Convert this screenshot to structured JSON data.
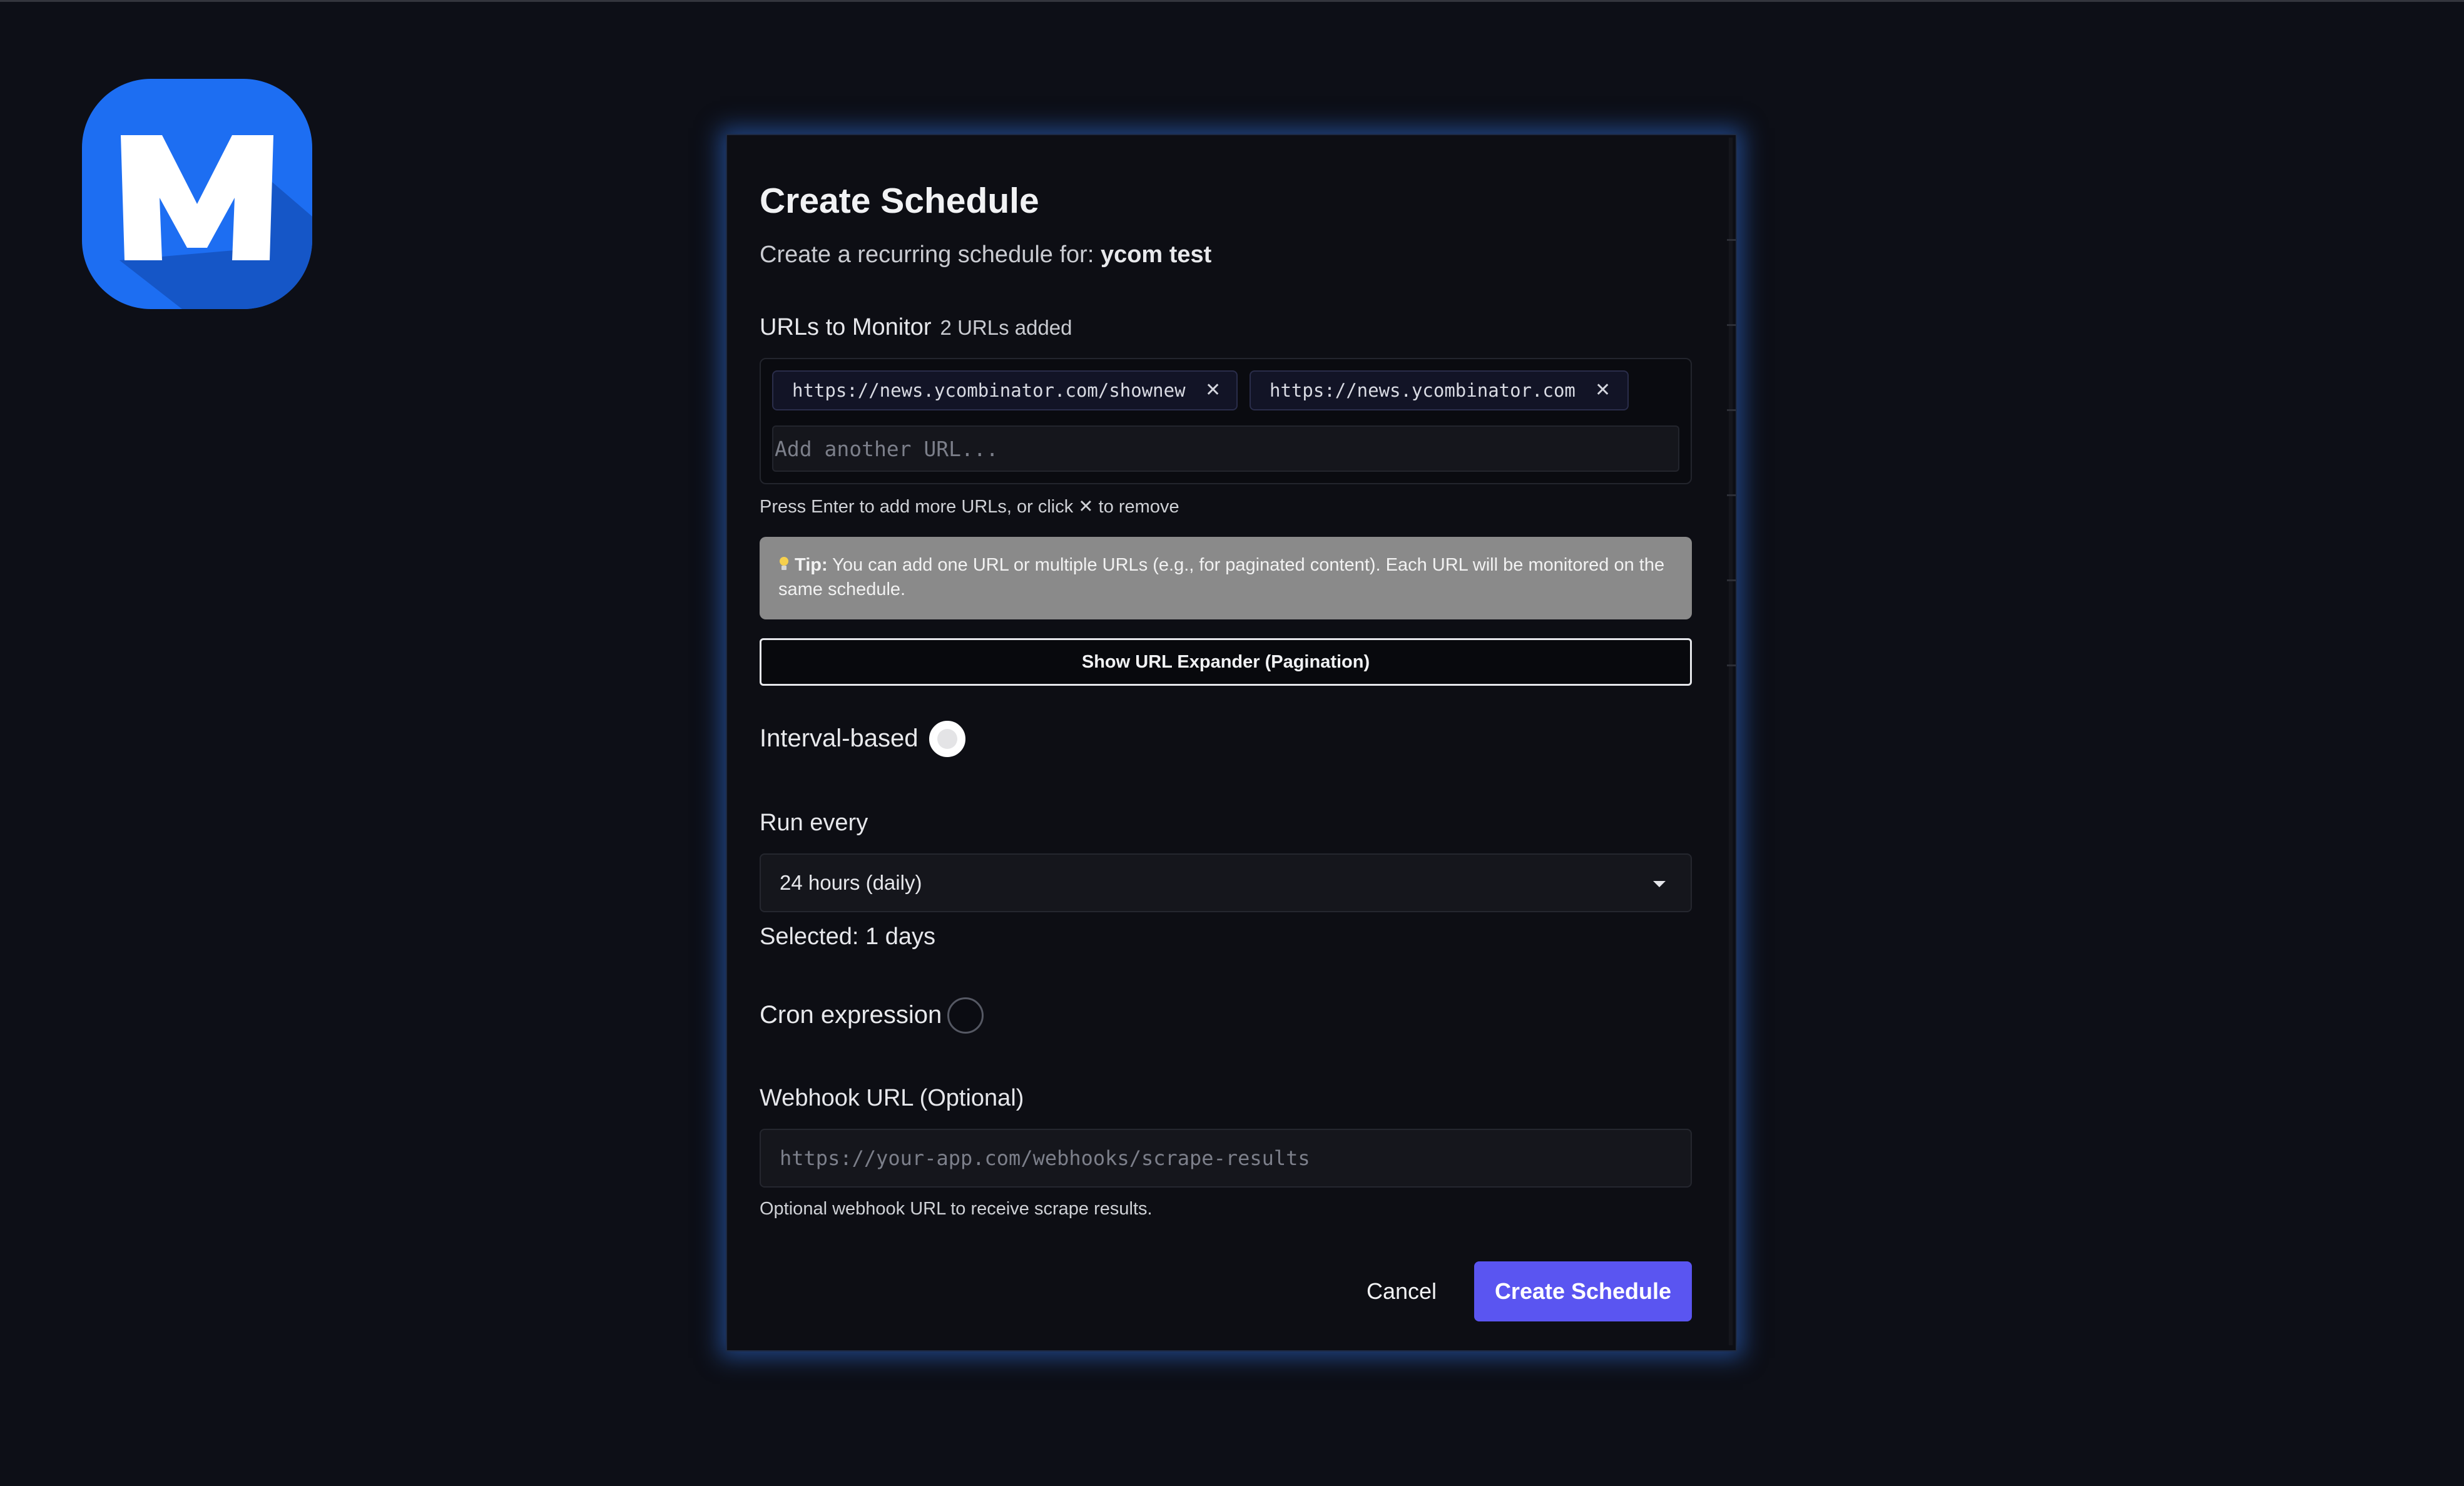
{
  "app": {
    "logo_letter": "M",
    "logo_color": "#1d6ef2",
    "logo_icon": "m-letter-logo-icon"
  },
  "modal": {
    "title": "Create Schedule",
    "subtitle_prefix": "Create a recurring schedule for: ",
    "subtitle_name": "ycom test"
  },
  "urls": {
    "label": "URLs to Monitor",
    "count_text": "2 URLs added",
    "items": [
      {
        "url": "https://news.ycombinator.com/shownew",
        "remove_glyph": "✕"
      },
      {
        "url": "https://news.ycombinator.com",
        "remove_glyph": "✕"
      }
    ],
    "add_placeholder": "Add another URL...",
    "hint": "Press Enter to add more URLs, or click ✕ to remove"
  },
  "tip": {
    "icon": "lightbulb-icon",
    "label": "Tip:",
    "text": " You can add one URL or multiple URLs (e.g., for paginated content). Each URL will be monitored on the same schedule."
  },
  "expander": {
    "label": "Show URL Expander (Pagination)"
  },
  "schedule": {
    "interval_label": "Interval-based",
    "interval_selected": true,
    "run_every_label": "Run every",
    "run_every_value": "24 hours (daily)",
    "selected_text": "Selected: 1 days",
    "cron_label": "Cron expression",
    "cron_selected": false
  },
  "webhook": {
    "label": "Webhook URL (Optional)",
    "placeholder": "https://your-app.com/webhooks/scrape-results",
    "help": "Optional webhook URL to receive scrape results."
  },
  "actions": {
    "cancel_label": "Cancel",
    "create_label": "Create Schedule",
    "create_color": "#5a55f1"
  }
}
